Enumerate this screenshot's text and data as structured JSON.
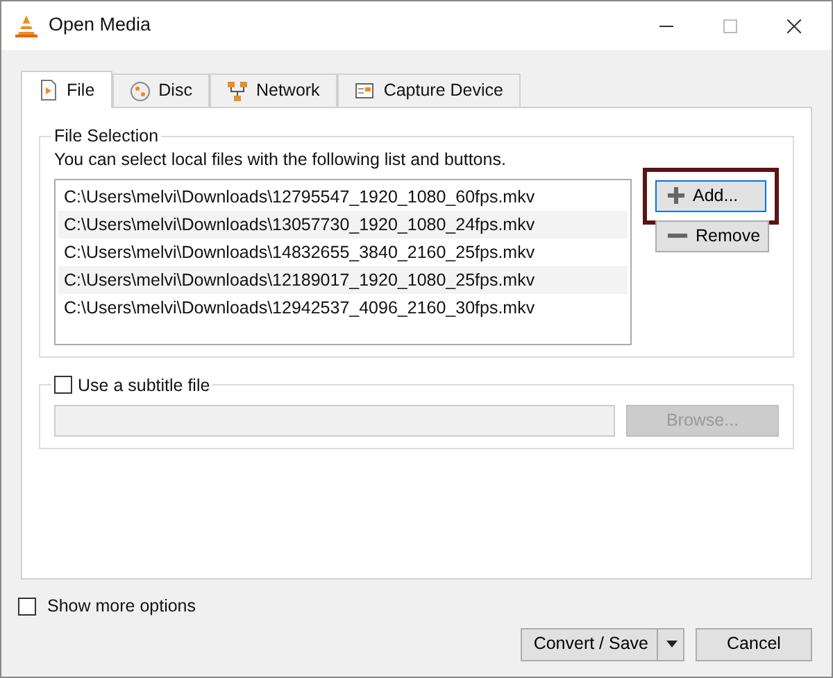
{
  "window": {
    "title": "Open Media"
  },
  "tabs": [
    {
      "label": "File",
      "kind": "file",
      "selected": true
    },
    {
      "label": "Disc",
      "kind": "disc",
      "selected": false
    },
    {
      "label": "Network",
      "kind": "network",
      "selected": false
    },
    {
      "label": "Capture Device",
      "kind": "capture",
      "selected": false
    }
  ],
  "file_selection": {
    "title": "File Selection",
    "hint": "You can select local files with the following list and buttons.",
    "files": [
      "C:\\Users\\melvi\\Downloads\\12795547_1920_1080_60fps.mkv",
      "C:\\Users\\melvi\\Downloads\\13057730_1920_1080_24fps.mkv",
      "C:\\Users\\melvi\\Downloads\\14832655_3840_2160_25fps.mkv",
      "C:\\Users\\melvi\\Downloads\\12189017_1920_1080_25fps.mkv",
      "C:\\Users\\melvi\\Downloads\\12942537_4096_2160_30fps.mkv"
    ],
    "add_button": {
      "label": "Add...",
      "highlighted": true
    },
    "remove_button": {
      "label": "Remove"
    }
  },
  "subtitle": {
    "label": "Use a subtitle file",
    "checked": false,
    "browse_label": "Browse..."
  },
  "show_more_options": {
    "label": "Show more options",
    "checked": false
  },
  "buttons": {
    "convert": "Convert / Save",
    "cancel": "Cancel"
  }
}
